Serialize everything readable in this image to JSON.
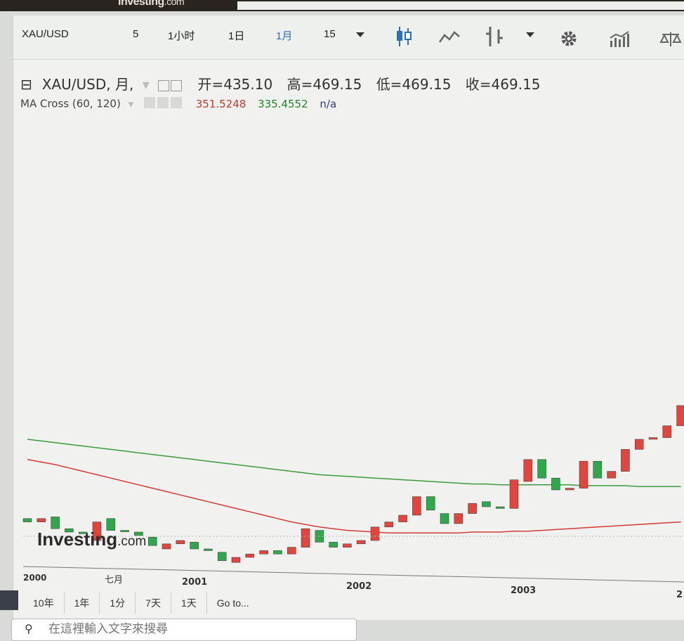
{
  "topbar": {
    "logo_bold": "Investing",
    "logo_suffix": ".com"
  },
  "toolbar": {
    "symbol": "XAU/USD",
    "intervals": [
      "5",
      "1小时",
      "1日",
      "1月",
      "15"
    ],
    "active_interval": "1月",
    "icons": [
      "candlestick-icon",
      "line-chart-icon",
      "bar-style-icon",
      "dropdown-arrow-icon",
      "gear-icon",
      "indicators-icon",
      "compare-scale-icon"
    ]
  },
  "legend": {
    "title": "XAU/USD, 月,",
    "open": "开=435.10",
    "high": "高=469.15",
    "low": "低=469.15",
    "close": "收=469.15"
  },
  "ma": {
    "label": "MA Cross (60, 120)",
    "value_red": "351.5248",
    "value_green": "335.4552",
    "value_na": "n/a"
  },
  "watermark": {
    "bold": "Investing",
    "suffix": ".com"
  },
  "x_axis": {
    "labels": [
      "2000",
      "七月",
      "2001",
      "2002",
      "2003",
      "2"
    ]
  },
  "range_buttons": [
    "10年",
    "1年",
    "1分",
    "7天",
    "1天",
    "Go to..."
  ],
  "search": {
    "placeholder": "在這裡輸入文字來搜尋"
  },
  "colors": {
    "up": "#e0463e",
    "down": "#2ea84a",
    "ma_green": "#3c9a3c",
    "ma_red": "#d23a36",
    "accent": "#2d6fb7"
  },
  "chart_data": {
    "type": "candlestick",
    "series": [
      {
        "name": "MA Cross (60, 120)",
        "values_note": "two moving averages"
      }
    ],
    "candles": [
      {
        "o": 12,
        "c": 16,
        "dir": "down"
      },
      {
        "o": 16,
        "c": 12,
        "dir": "up"
      },
      {
        "o": 18,
        "c": 4,
        "dir": "down"
      },
      {
        "o": 4,
        "c": 0,
        "dir": "down"
      },
      {
        "o": 0,
        "c": -2,
        "dir": "down"
      },
      {
        "o": -10,
        "c": 12,
        "dir": "up"
      },
      {
        "o": 16,
        "c": 2,
        "dir": "down"
      },
      {
        "o": 2,
        "c": 1,
        "dir": "down"
      },
      {
        "o": 0,
        "c": -4,
        "dir": "down"
      },
      {
        "o": -6,
        "c": -16,
        "dir": "down"
      },
      {
        "o": -20,
        "c": -14,
        "dir": "up"
      },
      {
        "o": -14,
        "c": -10,
        "dir": "up"
      },
      {
        "o": -12,
        "c": -20,
        "dir": "down"
      },
      {
        "o": -20,
        "c": -22,
        "dir": "down"
      },
      {
        "o": -24,
        "c": -34,
        "dir": "down"
      },
      {
        "o": -36,
        "c": -30,
        "dir": "up"
      },
      {
        "o": -30,
        "c": -26,
        "dir": "up"
      },
      {
        "o": -26,
        "c": -22,
        "dir": "up"
      },
      {
        "o": -22,
        "c": -26,
        "dir": "down"
      },
      {
        "o": -26,
        "c": -18,
        "dir": "up"
      },
      {
        "o": -18,
        "c": 4,
        "dir": "up"
      },
      {
        "o": 2,
        "c": -12,
        "dir": "down"
      },
      {
        "o": -12,
        "c": -18,
        "dir": "down"
      },
      {
        "o": -18,
        "c": -14,
        "dir": "up"
      },
      {
        "o": -14,
        "c": -10,
        "dir": "up"
      },
      {
        "o": -10,
        "c": 6,
        "dir": "up"
      },
      {
        "o": 6,
        "c": 12,
        "dir": "up"
      },
      {
        "o": 12,
        "c": 20,
        "dir": "up"
      },
      {
        "o": 20,
        "c": 42,
        "dir": "up"
      },
      {
        "o": 42,
        "c": 26,
        "dir": "down"
      },
      {
        "o": 22,
        "c": 10,
        "dir": "down"
      },
      {
        "o": 10,
        "c": 22,
        "dir": "up"
      },
      {
        "o": 22,
        "c": 34,
        "dir": "up"
      },
      {
        "o": 36,
        "c": 30,
        "dir": "down"
      },
      {
        "o": 30,
        "c": 28,
        "dir": "down"
      },
      {
        "o": 28,
        "c": 62,
        "dir": "up"
      },
      {
        "o": 60,
        "c": 86,
        "dir": "up"
      },
      {
        "o": 86,
        "c": 64,
        "dir": "down"
      },
      {
        "o": 64,
        "c": 50,
        "dir": "down"
      },
      {
        "o": 50,
        "c": 52,
        "dir": "up"
      },
      {
        "o": 52,
        "c": 84,
        "dir": "up"
      },
      {
        "o": 84,
        "c": 64,
        "dir": "down"
      },
      {
        "o": 64,
        "c": 72,
        "dir": "up"
      },
      {
        "o": 72,
        "c": 98,
        "dir": "up"
      },
      {
        "o": 98,
        "c": 110,
        "dir": "up"
      },
      {
        "o": 110,
        "c": 112,
        "dir": "up"
      },
      {
        "o": 112,
        "c": 126,
        "dir": "up"
      },
      {
        "o": 126,
        "c": 150,
        "dir": "up"
      }
    ],
    "ma_green": [
      110,
      108,
      106,
      104,
      102,
      100,
      98,
      96,
      94,
      92,
      90,
      88,
      86,
      84,
      82,
      80,
      78,
      76,
      74,
      72,
      70,
      68,
      67,
      66,
      65,
      64,
      63,
      62,
      61,
      60,
      59,
      58,
      57,
      57,
      56,
      56,
      56,
      56,
      56,
      56,
      55,
      55,
      55,
      55,
      54,
      54,
      54,
      54
    ],
    "ma_red": [
      86,
      83,
      80,
      76,
      72,
      68,
      64,
      60,
      56,
      52,
      48,
      44,
      40,
      36,
      32,
      28,
      24,
      20,
      16,
      12,
      9,
      6,
      4,
      2,
      1,
      0,
      -1,
      -1,
      -1,
      -1,
      -1,
      -1,
      0,
      0,
      0,
      1,
      1,
      2,
      3,
      4,
      5,
      6,
      7,
      8,
      9,
      10,
      11,
      12
    ]
  }
}
